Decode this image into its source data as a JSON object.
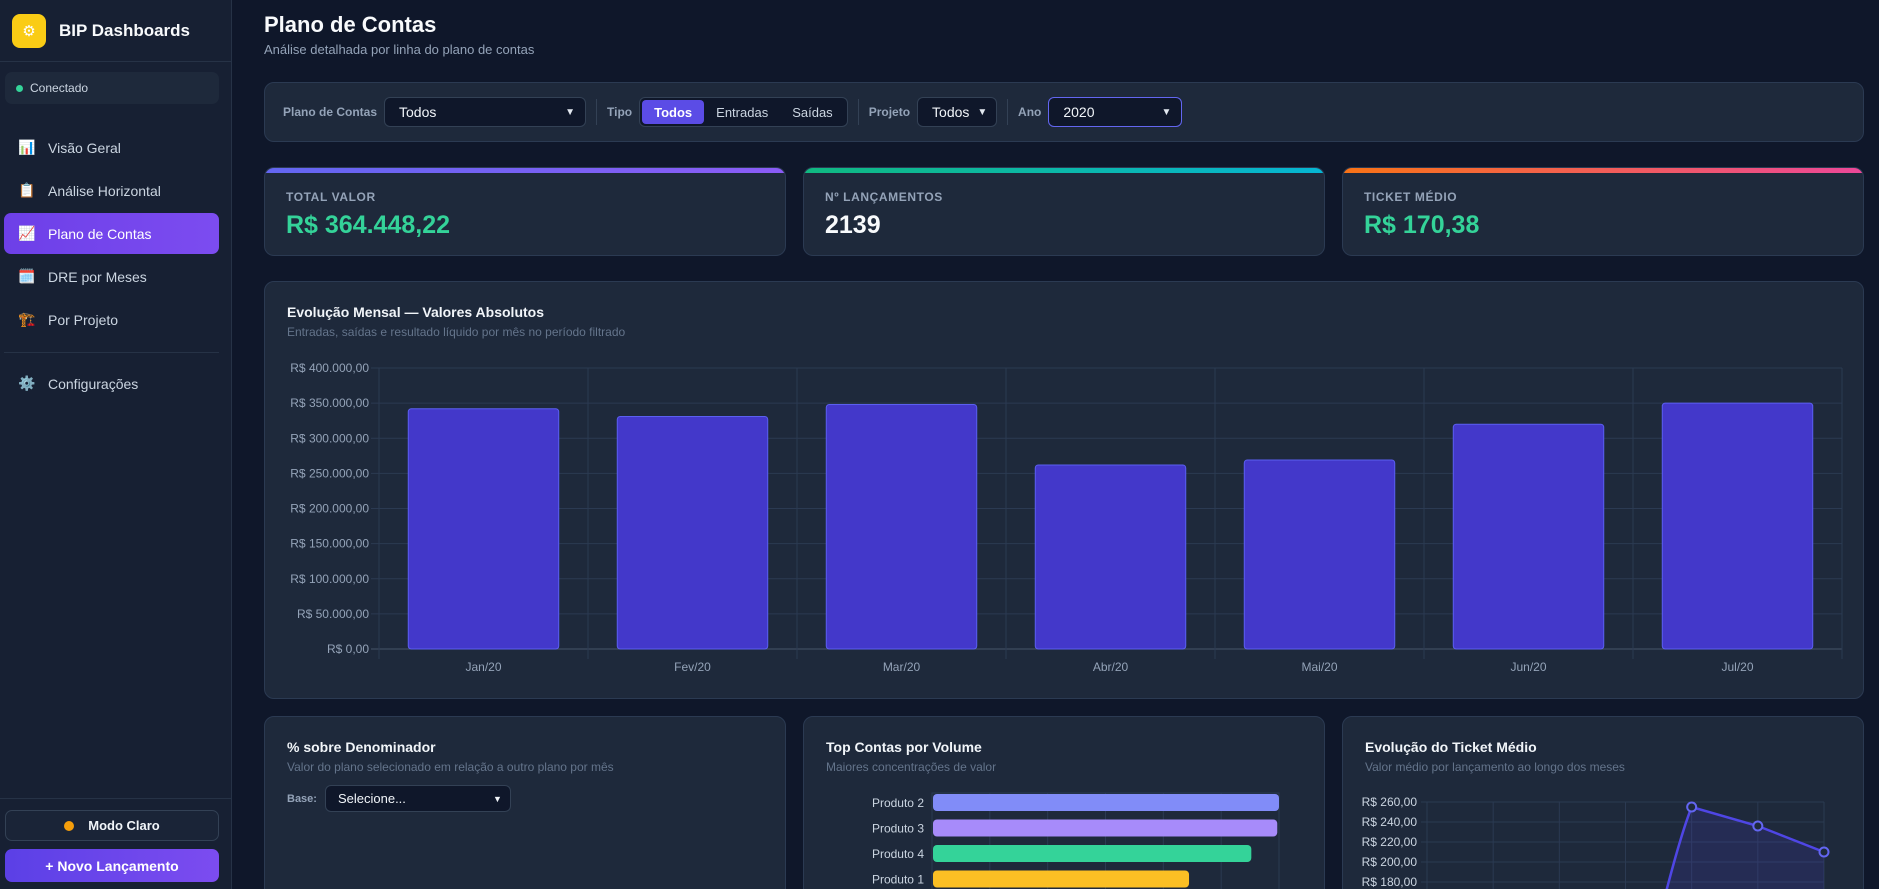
{
  "sidebar": {
    "brand": "BIP Dashboards",
    "brand_icon": "gear-icon",
    "status": "Conectado",
    "items": [
      {
        "icon": "📊",
        "label": "Visão Geral"
      },
      {
        "icon": "📋",
        "label": "Análise Horizontal"
      },
      {
        "icon": "📈",
        "label": "Plano de Contas"
      },
      {
        "icon": "🗓️",
        "label": "DRE por Meses"
      },
      {
        "icon": "🏗️",
        "label": "Por Projeto"
      }
    ],
    "settings": {
      "icon": "⚙️",
      "label": "Configurações"
    },
    "light_mode_label": "Modo Claro",
    "new_entry_label": "+ Novo Lançamento"
  },
  "header": {
    "title": "Plano de Contas",
    "subtitle": "Análise detalhada por linha do plano de contas"
  },
  "filters": {
    "plano_label": "Plano de Contas",
    "plano_value": "Todos",
    "tipo_label": "Tipo",
    "tipo_options": [
      "Todos",
      "Entradas",
      "Saídas"
    ],
    "projeto_label": "Projeto",
    "projeto_value": "Todos",
    "ano_label": "Ano",
    "ano_value": "2020"
  },
  "kpis": [
    {
      "label": "TOTAL VALOR",
      "value": "R$ 364.448,22",
      "color": "#34d399"
    },
    {
      "label": "Nº LANÇAMENTOS",
      "value": "2139",
      "color": "#f8fafc"
    },
    {
      "label": "TICKET MÉDIO",
      "value": "R$ 170,38",
      "color": "#34d399"
    }
  ],
  "monthly": {
    "title": "Evolução Mensal — Valores Absolutos",
    "subtitle": "Entradas, saídas e resultado líquido por mês no período filtrado"
  },
  "denominador": {
    "title": "% sobre Denominador",
    "subtitle": "Valor do plano selecionado em relação a outro plano por mês",
    "base_label": "Base:",
    "base_value": "Selecione..."
  },
  "top_contas": {
    "title": "Top Contas por Volume",
    "subtitle": "Maiores concentrações de valor"
  },
  "ticket": {
    "title": "Evolução do Ticket Médio",
    "subtitle": "Valor médio por lançamento ao longo dos meses"
  },
  "chart_data": [
    {
      "type": "bar",
      "categories": [
        "Jan/20",
        "Fev/20",
        "Mar/20",
        "Abr/20",
        "Mai/20",
        "Jun/20",
        "Jul/20"
      ],
      "values": [
        342000,
        331000,
        348000,
        262000,
        269000,
        320000,
        350000
      ],
      "ylim": [
        0,
        400000
      ],
      "yticks": [
        "R$ 0,00",
        "R$ 50.000,00",
        "R$ 100.000,00",
        "R$ 150.000,00",
        "R$ 200.000,00",
        "R$ 250.000,00",
        "R$ 300.000,00",
        "R$ 350.000,00",
        "R$ 400.000,00"
      ],
      "color": "#4338ca",
      "grid": true
    },
    {
      "type": "bar",
      "orientation": "horizontal",
      "categories": [
        "Produto 2",
        "Produto 3",
        "Produto 4",
        "Produto 1"
      ],
      "values": [
        100,
        99.5,
        92,
        74
      ],
      "colors": [
        "#818cf8",
        "#a78bfa",
        "#34d399",
        "#fbbf24"
      ]
    },
    {
      "type": "line",
      "y": [
        null,
        null,
        null,
        null,
        255,
        236,
        210
      ],
      "yticks": [
        "R$ 260,00",
        "R$ 240,00",
        "R$ 220,00",
        "R$ 200,00",
        "R$ 180,00"
      ],
      "color": "#4f46e5",
      "grid": true
    }
  ]
}
